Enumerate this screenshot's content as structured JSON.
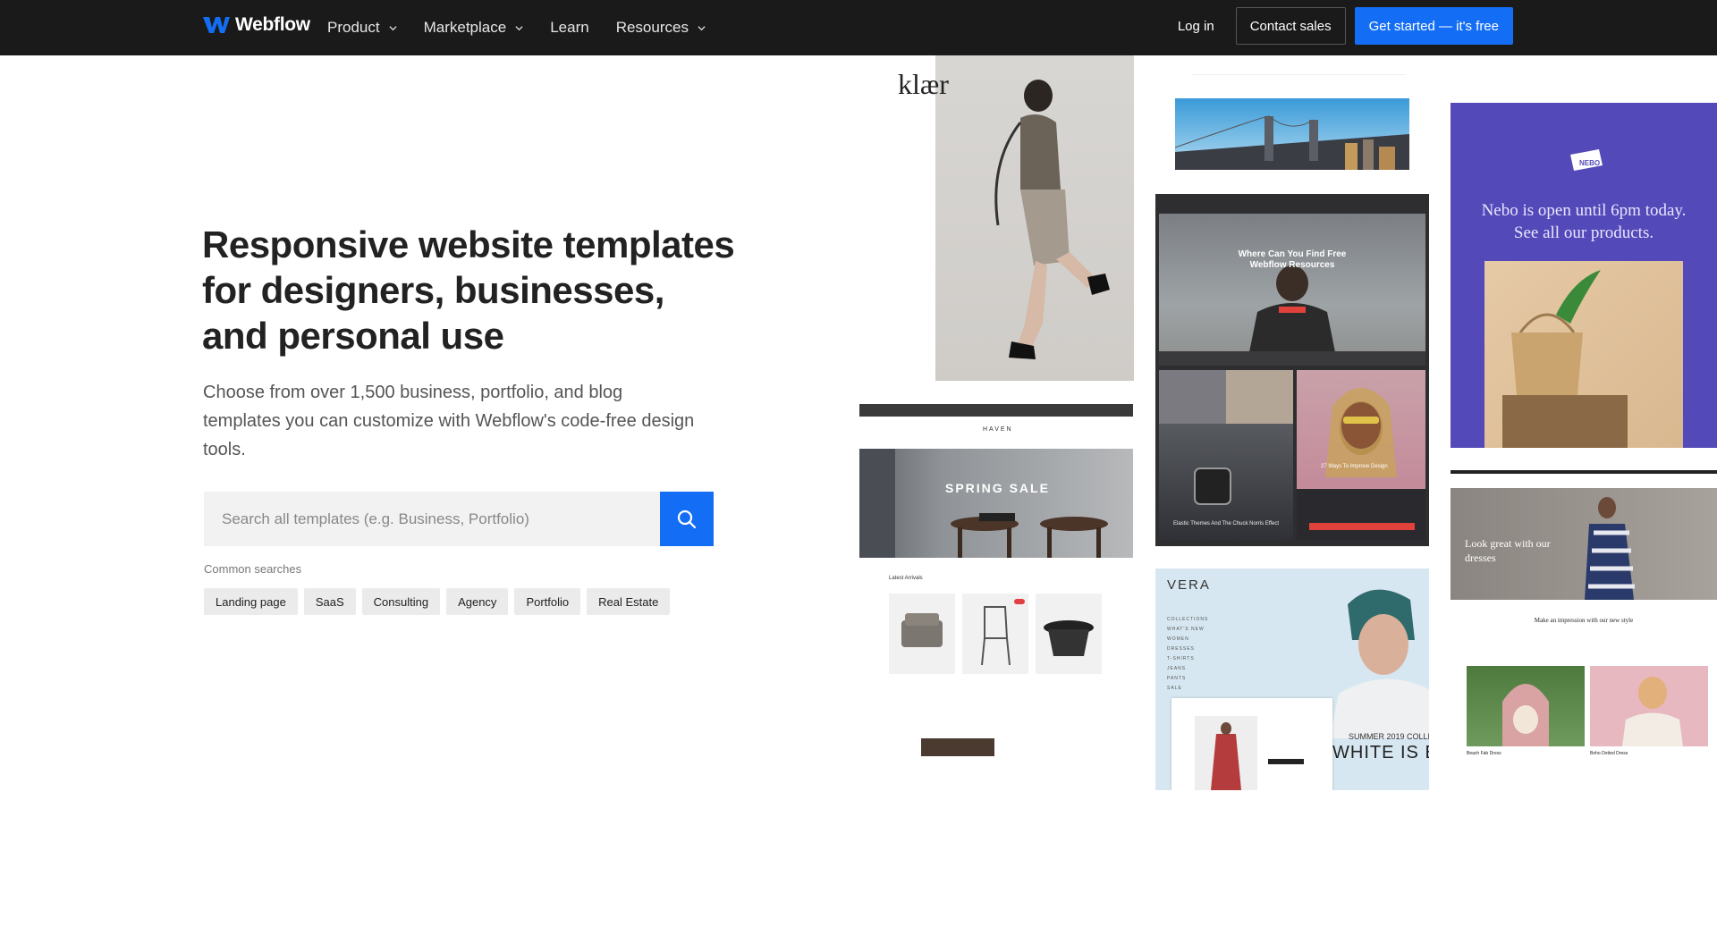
{
  "nav": {
    "brand": "Webflow",
    "links": [
      {
        "label": "Product",
        "dropdown": true
      },
      {
        "label": "Marketplace",
        "dropdown": true
      },
      {
        "label": "Learn",
        "dropdown": false
      },
      {
        "label": "Resources",
        "dropdown": true
      }
    ],
    "login": "Log in",
    "contact_sales": "Contact sales",
    "get_started": "Get started — it's free"
  },
  "hero": {
    "title": "Responsive website templates for designers, businesses, and personal use",
    "subtitle": "Choose from over 1,500 business, portfolio, and blog templates you can customize with Webflow's code-free design tools.",
    "search_placeholder": "Search all templates (e.g. Business, Portfolio)",
    "common_label": "Common searches",
    "chips": [
      "Landing page",
      "SaaS",
      "Consulting",
      "Agency",
      "Portfolio",
      "Real Estate"
    ]
  },
  "gallery": {
    "klaer": {
      "logo": "klær"
    },
    "haven": {
      "brand": "HAVEN",
      "headline": "SPRING SALE",
      "section": "Latest Arrivals"
    },
    "digest": {
      "headline": "Where Can You Find Free Webflow Resources",
      "card1": "27 Ways To Improve Design",
      "card2": "Elastic Themes And The Chuck Norris Effect"
    },
    "vera": {
      "brand": "VERA",
      "menu": [
        "COLLECTIONS",
        "WHAT'S NEW",
        "WOMEN",
        "DRESSES",
        "T-SHIRTS",
        "JEANS",
        "PANTS",
        "SALE"
      ],
      "caption": "SUMMER 2019 COLLE",
      "headline": "WHITE IS E"
    },
    "nebo": {
      "headline": "Nebo is open until 6pm today. See all our products.",
      "logo": "NEBO"
    },
    "moda": {
      "headline": "Look great with our dresses",
      "section": "Make an impression with our new style",
      "item1": "Beach Fab Dress",
      "item2": "Boho Dotted Dress"
    }
  },
  "colors": {
    "nav_bg": "#1a1a1a",
    "accent": "#146ef5",
    "nebo_bg": "#5449b8"
  }
}
